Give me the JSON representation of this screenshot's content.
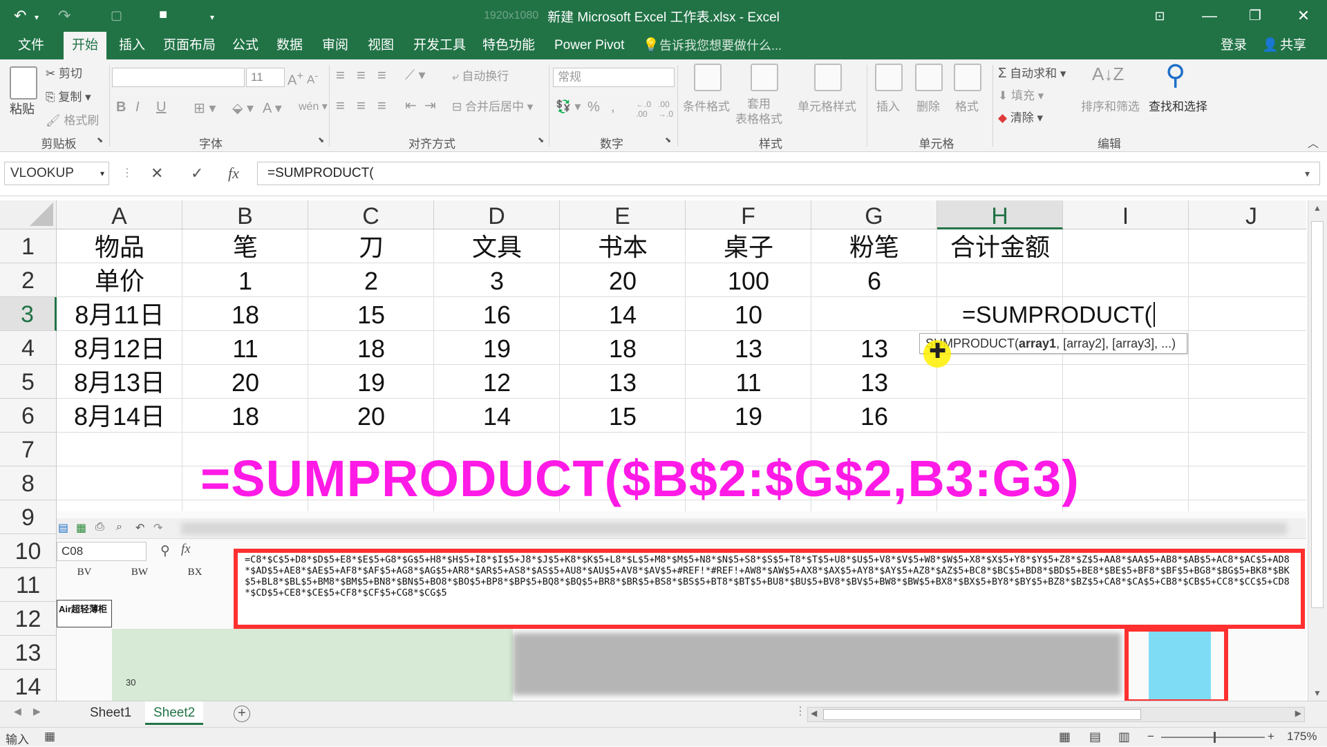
{
  "titlebar": {
    "title": "新建 Microsoft Excel 工作表.xlsx - Excel",
    "faded_text": "1920x1080"
  },
  "menu": {
    "tabs": [
      "文件",
      "开始",
      "插入",
      "页面布局",
      "公式",
      "数据",
      "审阅",
      "视图",
      "开发工具",
      "特色功能",
      "Power Pivot"
    ],
    "active": "开始",
    "tell_me": "告诉我您想要做什么...",
    "login": "登录",
    "share": "共享"
  },
  "ribbon": {
    "clipboard": {
      "paste": "粘贴",
      "cut": "剪切",
      "copy": "复制",
      "format_painter": "格式刷",
      "group": "剪贴板"
    },
    "font": {
      "size": "11",
      "group": "字体",
      "bold": "B",
      "italic": "I",
      "underline": "U"
    },
    "alignment": {
      "wrap": "自动换行",
      "merge": "合并后居中",
      "group": "对齐方式"
    },
    "number": {
      "format": "常规",
      "percent": "%",
      "group": "数字"
    },
    "styles": {
      "conditional": "条件格式",
      "table": "套用\n表格格式",
      "cell_styles": "单元格样式",
      "group": "样式"
    },
    "cells": {
      "insert": "插入",
      "delete": "删除",
      "format": "格式",
      "group": "单元格"
    },
    "editing": {
      "autosum": "自动求和",
      "fill": "填充",
      "clear": "清除",
      "sort_filter": "排序和筛选",
      "find_select": "查找和选择",
      "group": "编辑"
    }
  },
  "formula_bar": {
    "name_box": "VLOOKUP",
    "cancel": "✕",
    "enter": "✓",
    "fx": "fx",
    "content": "=SUMPRODUCT("
  },
  "columns": [
    "A",
    "B",
    "C",
    "D",
    "E",
    "F",
    "G",
    "H",
    "I",
    "J"
  ],
  "selected_column": "H",
  "rows": [
    "1",
    "2",
    "3",
    "4",
    "5",
    "6",
    "7",
    "8",
    "9",
    "10",
    "11",
    "12",
    "13",
    "14"
  ],
  "selected_row": "3",
  "table": [
    [
      "物品",
      "笔",
      "刀",
      "文具",
      "书本",
      "桌子",
      "粉笔",
      "合计金额"
    ],
    [
      "单价",
      "1",
      "2",
      "3",
      "20",
      "100",
      "6",
      ""
    ],
    [
      "8月11日",
      "18",
      "15",
      "16",
      "14",
      "10",
      "",
      ""
    ],
    [
      "8月12日",
      "11",
      "18",
      "19",
      "18",
      "13",
      "13",
      ""
    ],
    [
      "8月13日",
      "20",
      "19",
      "12",
      "13",
      "11",
      "13",
      ""
    ],
    [
      "8月14日",
      "18",
      "20",
      "14",
      "15",
      "19",
      "16",
      ""
    ]
  ],
  "active_cell": {
    "text": "=SUMPRODUCT("
  },
  "tooltip": {
    "fn": "SUMPRODUCT(",
    "arg1": "array1",
    "rest": ", [array2], [array3], ...)"
  },
  "overlay_formula": "=SUMPRODUCT($B$2:$G$2,B3:G3)",
  "embedded": {
    "name_box": "C08",
    "fx": "fx",
    "cols": [
      "BV",
      "BW",
      "BX"
    ],
    "cell_text": "Air超轻薄柜",
    "cell_sub": "30",
    "long_formula": "=C8*$C$5+D8*$D$5+E8*$E$5+G8*$G$5+H8*$H$5+I8*$I$5+J8*$J$5+K8*$K$5+L8*$L$5+M8*$M$5+N8*$N$5+S8*$S$5+T8*$T$5+U8*$U$5+V8*$V$5+W8*$W$5+X8*$X$5+Y8*$Y$5+Z8*$Z$5+AA8*$AA$5+AB8*$AB$5+AC8*$AC$5+AD8*$AD$5+AE8*$AE$5+AF8*$AF$5+AG8*$AG$5+AR8*$AR$5+AS8*$AS$5+AU8*$AU$5+AV8*$AV$5+#REF!*#REF!+AW8*$AW$5+AX8*$AX$5+AY8*$AY$5+AZ8*$AZ$5+BC8*$BC$5+BD8*$BD$5+BE8*$BE$5+BF8*$BF$5+BG8*$BG$5+BK8*$BK$5+BL8*$BL$5+BM8*$BM$5+BN8*$BN$5+BO8*$BO$5+BP8*$BP$5+BQ8*$BQ$5+BR8*$BR$5+BS8*$BS$5+BT8*$BT$5+BU8*$BU$5+BV8*$BV$5+BW8*$BW$5+BX8*$BX$5+BY8*$BY$5+BZ8*$BZ$5+CA8*$CA$5+CB8*$CB$5+CC8*$CC$5+CD8*$CD$5+CE8*$CE$5+CF8*$CF$5+CG8*$CG$5"
  },
  "sheets": [
    "Sheet1",
    "Sheet2"
  ],
  "active_sheet": "Sheet2",
  "status": {
    "mode": "输入",
    "zoom": "175%"
  },
  "colors": {
    "accent": "#217346",
    "overlay": "#ff1ae6",
    "highlight_red": "#ff3030"
  }
}
